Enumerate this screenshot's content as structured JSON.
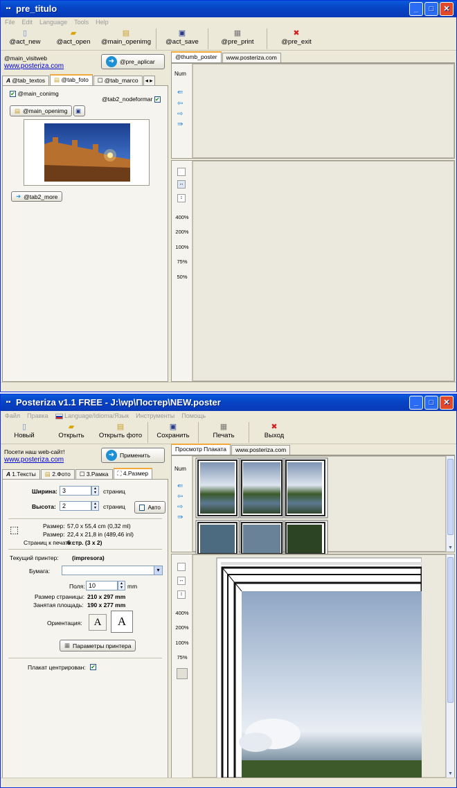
{
  "win1": {
    "title": "pre_titulo",
    "menu": [
      "File",
      "Edit",
      "Language",
      "Tools",
      "Help"
    ],
    "toolbar": {
      "new": "@act_new",
      "open": "@act_open",
      "openimg": "@main_openimg",
      "save": "@act_save",
      "print": "@pre_print",
      "exit": "@pre_exit"
    },
    "visit": "@main_visitweb",
    "site": "www.posteriza.com",
    "apply": "@pre_aplicar",
    "tabs": [
      "@tab_textos",
      "@tab_foto",
      "@tab_marco"
    ],
    "conimg": "@main_conimg",
    "nodeformar": "@tab2_nodeformar",
    "openimg_btn": "@main_openimg",
    "more": "@tab2_more",
    "view_tabs": [
      "@thumb_poster",
      "www.posteriza.com"
    ],
    "num": "Num",
    "zooms": [
      "400%",
      "200%",
      "100%",
      "75%",
      "50%"
    ]
  },
  "win2": {
    "title": "Posteriza v1.1 FREE - J:\\wp\\Постер\\NEW.poster",
    "menu": [
      "Файл",
      "Правка",
      "Language/Idioma/Язык",
      "Инструменты",
      "Помощь"
    ],
    "toolbar": {
      "new": "Новый",
      "open": "Открыть",
      "openimg": "Открыть фото",
      "save": "Сохранить",
      "print": "Печать",
      "exit": "Выход"
    },
    "visit": "Посети наш web-сайт!",
    "site": "www.posteriza.com",
    "apply": "Применить",
    "tabs": [
      "1.Тексты",
      "2.Фото",
      "3.Рамка",
      "4.Размер"
    ],
    "width_label": "Ширина:",
    "width_value": "3",
    "height_label": "Высота:",
    "height_value": "2",
    "pages": "страниц",
    "auto": "Авто",
    "size1_label": "Размер:",
    "size1_value": "57,0 x 55,4 cm (0,32 ml)",
    "size2_label": "Размер:",
    "size2_value": "22,4 x 21,8 in (489,46 inl)",
    "print_pages_label": "Страниц к печати:",
    "print_pages_value": "6 стр. (3 x 2)",
    "printer_label": "Текущий принтер:",
    "printer_value": "(impresora)",
    "paper_label": "Бумага:",
    "paper_value": "",
    "margins_label": "Поля:",
    "margins_value": "10",
    "margins_unit": "mm",
    "pagesize_label": "Размер страницы:",
    "pagesize_value": "210 x 297 mm",
    "area_label": "Занятая площадь:",
    "area_value": "190 x 277 mm",
    "orient_label": "Ориентация:",
    "printer_settings": "Параметры принтера",
    "centered_label": "Плакат центрирован:",
    "view_tabs": [
      "Просмотр Плаката",
      "www.posteriza.com"
    ],
    "num": "Num",
    "zooms": [
      "400%",
      "200%",
      "100%",
      "75%"
    ]
  },
  "colors": {
    "titlebar": "#0a5bdb",
    "window": "#ece9d8",
    "link": "#0000cc"
  }
}
